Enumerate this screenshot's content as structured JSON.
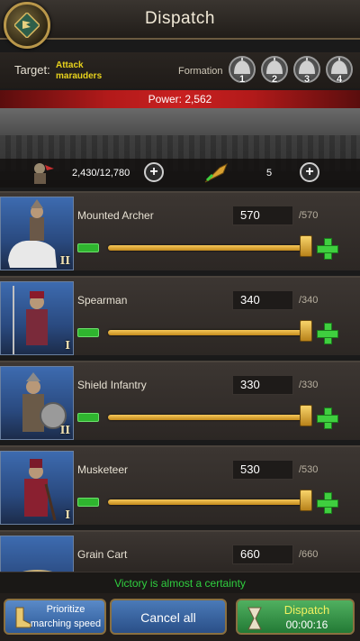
{
  "header": {
    "title": "Dispatch",
    "emblem_icon": "flag-emblem-icon"
  },
  "target": {
    "label": "Target:",
    "value": "Attack marauders"
  },
  "formation": {
    "label": "Formation",
    "slots": [
      "1",
      "2",
      "3",
      "4"
    ]
  },
  "power": {
    "text": "Power: 2,562"
  },
  "stats": {
    "troops": "2,430/12,780",
    "heroes": "5"
  },
  "units": [
    {
      "name": "Mounted Archer",
      "count": "570",
      "max": "/570",
      "rank": "II",
      "level": 1.0
    },
    {
      "name": "Spearman",
      "count": "340",
      "max": "/340",
      "rank": "I",
      "level": 1.0
    },
    {
      "name": "Shield Infantry",
      "count": "330",
      "max": "/330",
      "rank": "II",
      "level": 1.0
    },
    {
      "name": "Musketeer",
      "count": "530",
      "max": "/530",
      "rank": "I",
      "level": 1.0
    },
    {
      "name": "Grain Cart",
      "count": "660",
      "max": "/660",
      "rank": "",
      "level": 1.0
    }
  ],
  "status": {
    "victory": "Victory is almost a certainty"
  },
  "buttons": {
    "prioritize_line1": "Prioritize",
    "prioritize_line2": "marching speed",
    "cancel": "Cancel all",
    "dispatch": "Dispatch",
    "dispatch_time": "00:00:16"
  }
}
